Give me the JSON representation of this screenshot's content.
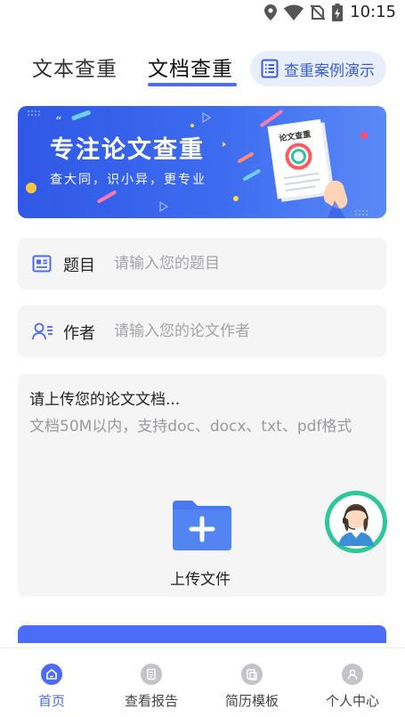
{
  "status_bar": {
    "time": "10:15",
    "icons": [
      "location-icon",
      "wifi-icon",
      "no-sim-icon",
      "battery-charging-icon"
    ]
  },
  "tabs": [
    {
      "label": "文本查重",
      "active": false
    },
    {
      "label": "文档查重",
      "active": true
    }
  ],
  "case_button": {
    "label": "查重案例演示",
    "icon": "document-list-icon"
  },
  "banner": {
    "title": "专注论文查重",
    "subtitle": "查大同，识小异，更专业",
    "paper_title": "论文查重"
  },
  "form": {
    "title_field": {
      "label": "题目",
      "placeholder": "请输入您的题目",
      "value": "",
      "icon": "title-card-icon"
    },
    "author_field": {
      "label": "作者",
      "placeholder": "请输入您的论文作者",
      "value": "",
      "icon": "person-list-icon"
    }
  },
  "upload": {
    "prompt": "请上传您的论文文档...",
    "hint": "文档50M以内，支持doc、docx、txt、pdf格式",
    "button_label": "上传文件",
    "icon": "folder-plus-icon"
  },
  "customer_service": {
    "icon": "customer-service-avatar"
  },
  "bottom_nav": [
    {
      "label": "首页",
      "icon": "home-icon",
      "active": true
    },
    {
      "label": "查看报告",
      "icon": "report-icon",
      "active": false
    },
    {
      "label": "简历模板",
      "icon": "template-icon",
      "active": false
    },
    {
      "label": "个人中心",
      "icon": "person-icon",
      "active": false
    }
  ],
  "colors": {
    "accent": "#4a6cf7",
    "banner": "#3d6cf0",
    "field_bg": "#f5f5f6",
    "service": "#2dc79a"
  }
}
